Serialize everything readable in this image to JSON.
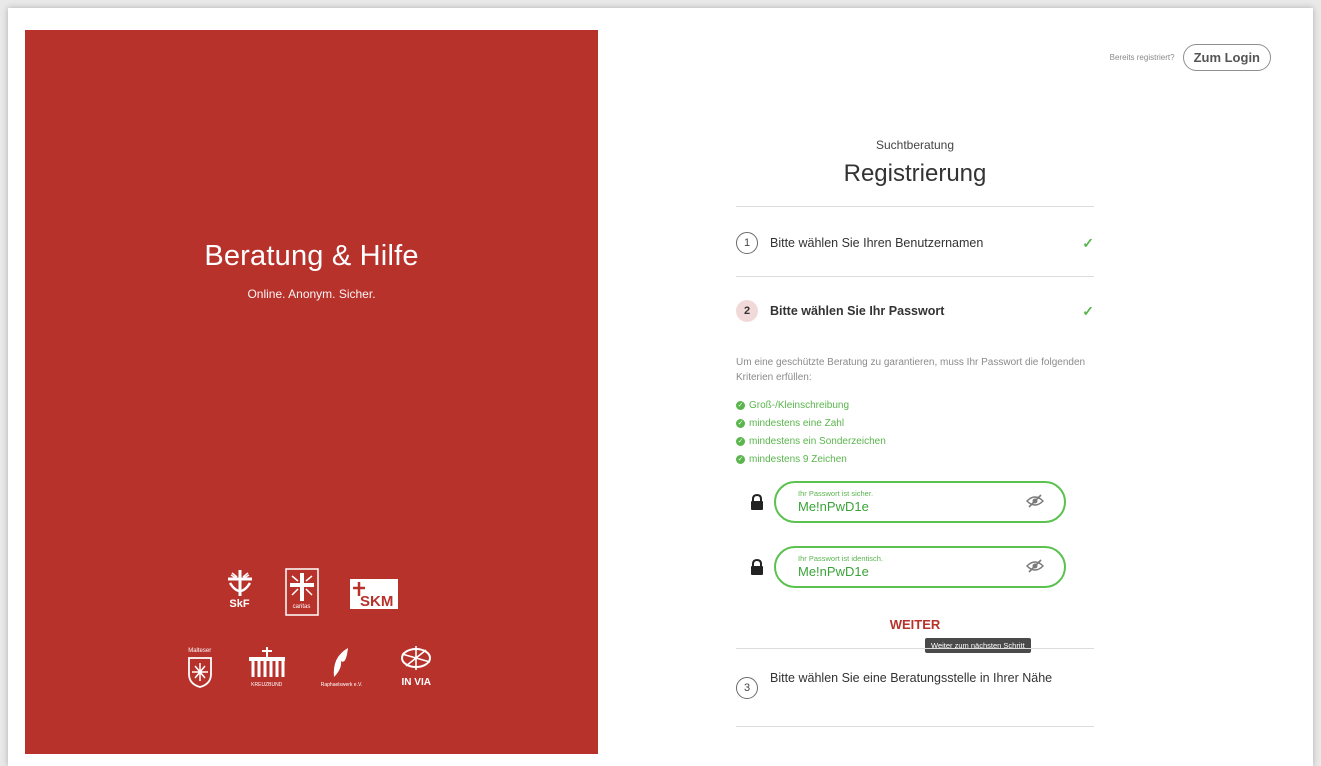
{
  "brand": {
    "title": "Beratung & Hilfe",
    "subtitle": "Online. Anonym. Sicher."
  },
  "partner_logos": {
    "row1": [
      {
        "name": "skf-logo",
        "caption": "SkF"
      },
      {
        "name": "caritas-logo",
        "caption": "caritas"
      },
      {
        "name": "skm-logo",
        "caption": "SKM"
      }
    ],
    "row2": [
      {
        "name": "malteser-logo",
        "caption": "Malteser"
      },
      {
        "name": "kreuzbund-logo",
        "caption": "KREUZBUND"
      },
      {
        "name": "raphaelswerk-logo",
        "caption": "Raphaelswerk e.V."
      },
      {
        "name": "in-via-logo",
        "caption": "IN VIA"
      }
    ]
  },
  "header": {
    "already_registered": "Bereits registriert?",
    "login_label": "Zum Login"
  },
  "form": {
    "kicker": "Suchtberatung",
    "title": "Registrierung",
    "steps": [
      {
        "number": "1",
        "label": "Bitte wählen Sie Ihren Benutzernamen",
        "done": true
      },
      {
        "number": "2",
        "label": "Bitte wählen Sie Ihr Passwort",
        "done": true
      },
      {
        "number": "3",
        "label": "Bitte wählen Sie eine Beratungsstelle in Ihrer Nähe",
        "done": false
      }
    ],
    "check_mark": "✓",
    "password_intro": "Um eine geschützte Beratung zu garantieren, muss Ihr Passwort die folgenden Kriterien erfüllen:",
    "criteria": [
      "Groß-/Kleinschreibung",
      "mindestens eine Zahl",
      "mindestens ein Sonderzeichen",
      "mindestens 9 Zeichen"
    ],
    "password_field": {
      "label": "Ihr Passwort ist sicher.",
      "value": "Me!nPwD1e"
    },
    "confirm_field": {
      "label": "Ihr Passwort ist identisch.",
      "value": "Me!nPwD1e"
    },
    "next_label": "WEITER",
    "next_tooltip": "Weiter zum nächsten Schritt"
  },
  "colors": {
    "brand_red": "#b8322c",
    "success_green": "#5ab54f",
    "step_active_bg": "#f1d9d9"
  }
}
